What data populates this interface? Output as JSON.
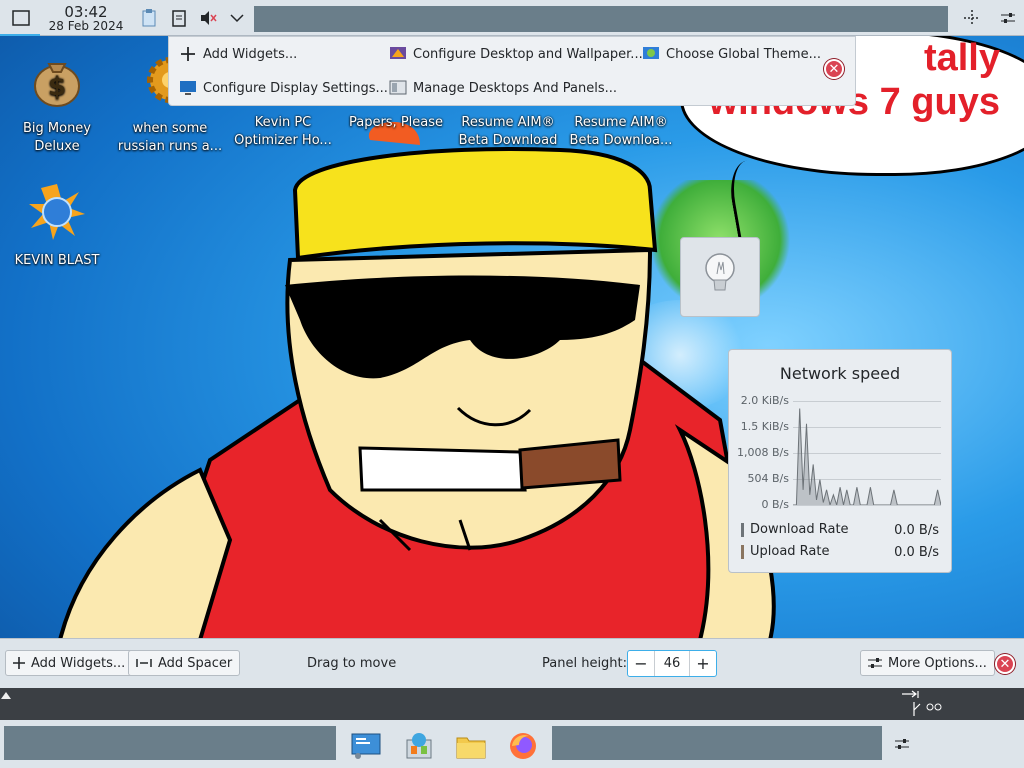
{
  "top_panel": {
    "clock_time": "03:42",
    "clock_date": "28 Feb 2024",
    "icons": [
      "show-desktop-icon",
      "clipboard-icon",
      "notes-icon",
      "volume-muted-icon",
      "chevron-down-icon",
      "move-handle-icon",
      "settings-sliders-icon"
    ]
  },
  "context_menu": {
    "items": [
      {
        "label": "Add Widgets...",
        "icon": "plus-icon"
      },
      {
        "label": "Configure Desktop and Wallpaper...",
        "icon": "desktop-settings-icon"
      },
      {
        "label": "Choose Global Theme...",
        "icon": "theme-icon"
      },
      {
        "label": "Configure Display Settings...",
        "icon": "display-icon"
      },
      {
        "label": "Manage Desktops And Panels...",
        "icon": "panels-icon"
      }
    ]
  },
  "desktop_icons": [
    {
      "label": "Big Money Deluxe",
      "icon": "money-bag-icon"
    },
    {
      "label": "when some russian runs a...",
      "icon": "gear-icon"
    },
    {
      "label": "Kevin PC Optimizer Ho...",
      "icon": "app-icon"
    },
    {
      "label": "Papers, Please",
      "icon": "app-icon"
    },
    {
      "label": "Resume AIM® Beta Download",
      "icon": "app-icon"
    },
    {
      "label": "Resume AIM® Beta Downloa...",
      "icon": "app-icon"
    },
    {
      "label": "KEVIN BLAST",
      "icon": "globe-burst-icon"
    }
  ],
  "speech_bubble": {
    "text_line1": "tally",
    "text_line2": "windows 7 guys"
  },
  "network_widget": {
    "title": "Network speed",
    "y_ticks": [
      "2.0 KiB/s",
      "1.5 KiB/s",
      "1,008 B/s",
      "504 B/s",
      "0 B/s"
    ],
    "download_label": "Download Rate",
    "download_value": "0.0 B/s",
    "upload_label": "Upload Rate",
    "upload_value": "0.0 B/s"
  },
  "chart_data": {
    "type": "line",
    "ylim": [
      0,
      2048
    ],
    "series": [
      {
        "name": "Download Rate",
        "values": [
          0,
          0,
          1900,
          300,
          1600,
          200,
          800,
          100,
          500,
          50,
          300,
          0,
          200,
          0,
          350,
          0,
          300,
          0,
          0,
          350,
          0,
          0,
          0,
          350,
          0,
          0,
          0,
          0,
          0,
          0,
          300,
          0,
          0,
          0,
          0,
          0,
          0,
          0,
          0,
          0,
          0,
          0,
          0,
          300,
          0
        ]
      }
    ]
  },
  "edit_toolbar": {
    "add_widgets": "Add Widgets...",
    "add_spacer": "Add Spacer",
    "drag_to_move": "Drag to move",
    "panel_height_label": "Panel height:",
    "panel_height_value": "46",
    "more_options": "More Options..."
  },
  "taskbar": {
    "apps": [
      "system-settings-icon",
      "discover-store-icon",
      "file-manager-icon",
      "firefox-icon"
    ]
  }
}
